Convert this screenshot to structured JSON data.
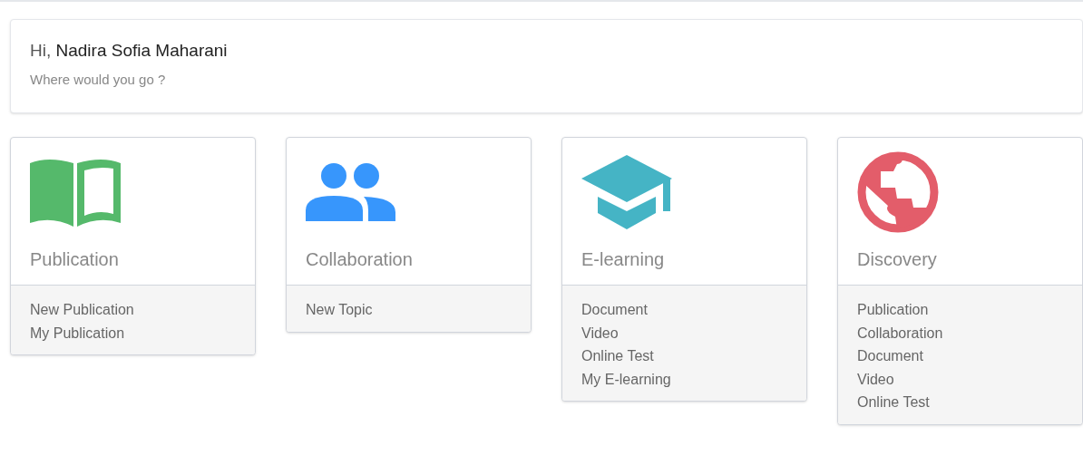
{
  "welcome": {
    "greeting": "Hi,",
    "name": "Nadira Sofia Maharani",
    "subtitle": "Where would you go ?"
  },
  "cards": [
    {
      "kind": "book",
      "color": "#55b96b",
      "title": "Publication",
      "links": [
        "New Publication",
        "My Publication"
      ]
    },
    {
      "kind": "people",
      "color": "#3796fc",
      "title": "Collaboration",
      "links": [
        "New Topic"
      ]
    },
    {
      "kind": "cap",
      "color": "#45b4c5",
      "title": "E-learning",
      "links": [
        "Document",
        "Video",
        "Online Test",
        "My E-learning"
      ]
    },
    {
      "kind": "globe",
      "color": "#e35d6a",
      "title": "Discovery",
      "links": [
        "Publication",
        "Collaboration",
        "Document",
        "Video",
        "Online Test"
      ]
    }
  ]
}
